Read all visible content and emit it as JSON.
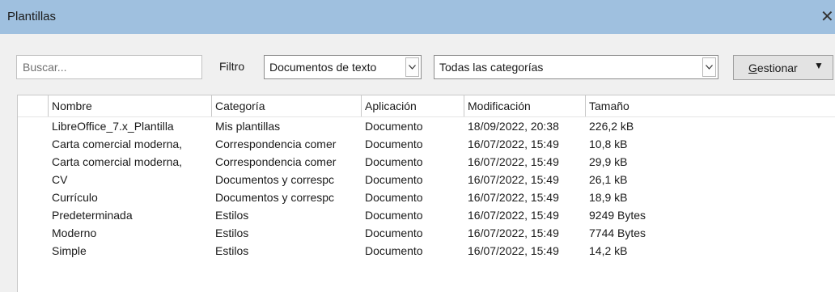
{
  "window": {
    "title": "Plantillas",
    "close_glyph": "✕"
  },
  "toolbar": {
    "search_placeholder": "Buscar...",
    "filter_label": "Filtro",
    "filter_value": "Documentos de texto",
    "category_value": "Todas las categorías",
    "manage_label": "Gestionar",
    "manage_caret": "▼"
  },
  "table": {
    "columns": [
      "Nombre",
      "Categoría",
      "Aplicación",
      "Modificación",
      "Tamaño"
    ],
    "rows": [
      [
        "LibreOffice_7.x_Plantilla",
        "Mis plantillas",
        "Documento",
        "18/09/2022, 20:38",
        "226,2 kB"
      ],
      [
        "Carta comercial moderna,",
        "Correspondencia comer",
        "Documento",
        "16/07/2022, 15:49",
        "10,8 kB"
      ],
      [
        "Carta comercial moderna,",
        "Correspondencia comer",
        "Documento",
        "16/07/2022, 15:49",
        "29,9 kB"
      ],
      [
        "CV",
        "Documentos y correspc",
        "Documento",
        "16/07/2022, 15:49",
        "26,1 kB"
      ],
      [
        "Currículo",
        "Documentos y correspc",
        "Documento",
        "16/07/2022, 15:49",
        "18,9 kB"
      ],
      [
        "Predeterminada",
        "Estilos",
        "Documento",
        "16/07/2022, 15:49",
        "9249 Bytes"
      ],
      [
        "Moderno",
        "Estilos",
        "Documento",
        "16/07/2022, 15:49",
        "7744 Bytes"
      ],
      [
        "Simple",
        "Estilos",
        "Documento",
        "16/07/2022, 15:49",
        "14,2 kB"
      ]
    ]
  },
  "colors": {
    "titlebar": "#9fc0df",
    "dialog_bg": "#f0f0f0",
    "list_bg": "#ffffff"
  }
}
